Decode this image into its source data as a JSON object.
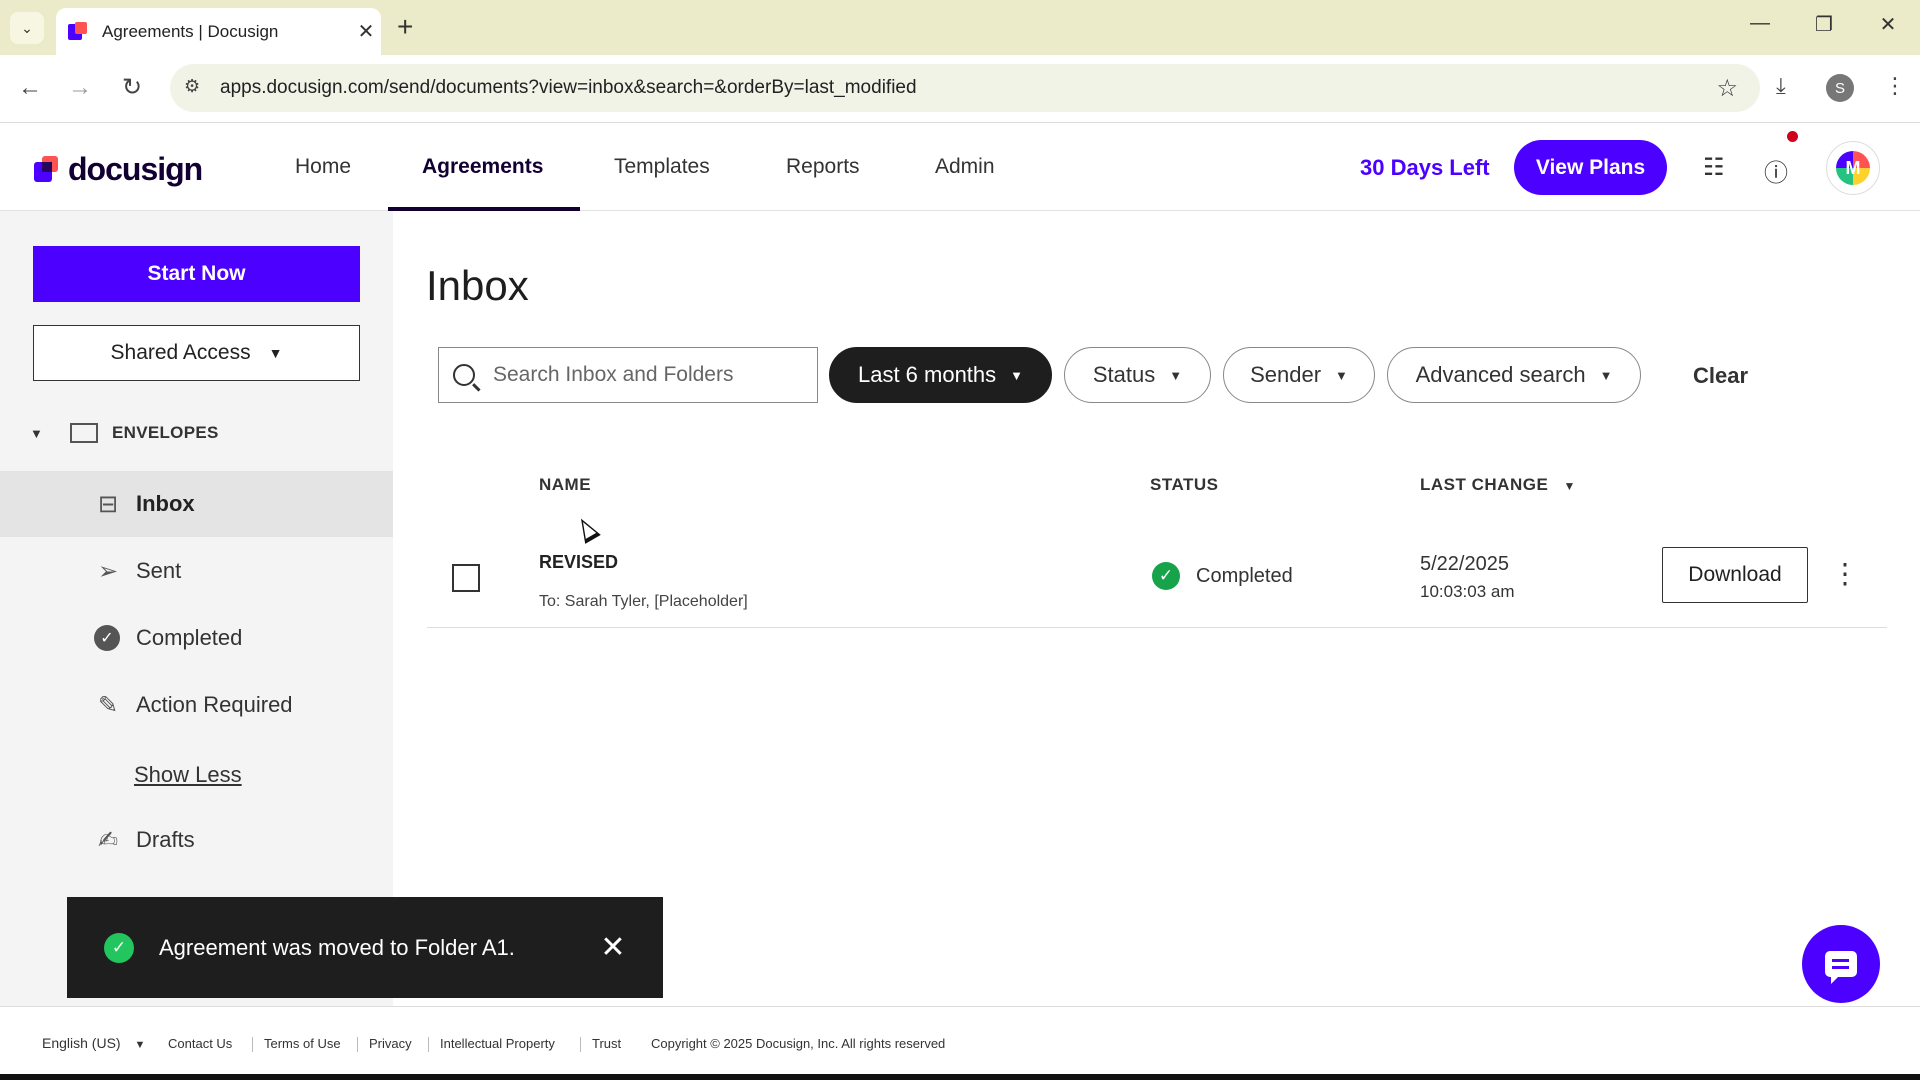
{
  "browser": {
    "tab_title": "Agreements | Docusign",
    "url": "apps.docusign.com/send/documents?view=inbox&search=&orderBy=last_modified",
    "profile_initial": "S"
  },
  "header": {
    "logo_text": "docusign",
    "nav": [
      {
        "label": "Home",
        "active": false
      },
      {
        "label": "Agreements",
        "active": true
      },
      {
        "label": "Templates",
        "active": false
      },
      {
        "label": "Reports",
        "active": false
      },
      {
        "label": "Admin",
        "active": false
      }
    ],
    "trial_text": "30 Days Left",
    "view_plans_label": "View Plans",
    "avatar_initial": "M"
  },
  "sidebar": {
    "start_now_label": "Start Now",
    "shared_access_label": "Shared Access",
    "envelopes_label": "ENVELOPES",
    "items": [
      {
        "label": "Inbox",
        "icon": "inbox-icon",
        "active": true
      },
      {
        "label": "Sent",
        "icon": "send-icon",
        "active": false
      },
      {
        "label": "Completed",
        "icon": "check-circle-icon",
        "active": false
      },
      {
        "label": "Action Required",
        "icon": "pen-icon",
        "active": false
      }
    ],
    "show_less_label": "Show Less",
    "drafts_label": "Drafts"
  },
  "main": {
    "title": "Inbox",
    "search_placeholder": "Search Inbox and Folders",
    "filters": {
      "date": "Last 6 months",
      "status": "Status",
      "sender": "Sender",
      "advanced": "Advanced search"
    },
    "clear_label": "Clear",
    "columns": {
      "name": "NAME",
      "status": "STATUS",
      "last_change": "LAST CHANGE"
    },
    "rows": [
      {
        "name": "REVISED",
        "recipients": "To: Sarah Tyler, [Placeholder]",
        "status": "Completed",
        "date": "5/22/2025",
        "time": "10:03:03 am",
        "action_label": "Download"
      }
    ]
  },
  "toast": {
    "message": "Agreement was moved to Folder A1."
  },
  "footer": {
    "language": "English (US)",
    "links": [
      "Contact Us",
      "Terms of Use",
      "Privacy",
      "Intellectual Property",
      "Trust"
    ],
    "copyright": "Copyright © 2025 Docusign, Inc. All rights reserved"
  },
  "colors": {
    "brand_purple": "#4c00ff",
    "brand_dark": "#130032",
    "success_green": "#16a34a",
    "toast_bg": "#1e1e1e"
  }
}
